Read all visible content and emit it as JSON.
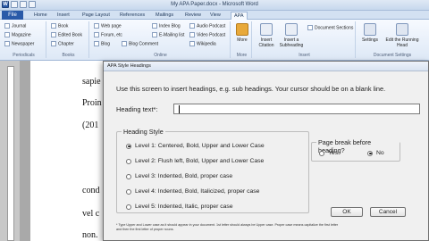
{
  "window": {
    "title": "My APA Paper.docx - Microsoft Word",
    "word_icon_letter": "W"
  },
  "ribbon_tabs": [
    "File",
    "Home",
    "Insert",
    "Page Layout",
    "References",
    "Mailings",
    "Review",
    "View",
    "APA"
  ],
  "ribbon": {
    "periodicals": {
      "label": "Periodicals",
      "items": [
        "Journal",
        "Magazine",
        "Newspaper"
      ]
    },
    "books": {
      "label": "Books",
      "items": [
        "Book",
        "Edited Book",
        "Chapter"
      ]
    },
    "online": {
      "label": "Online",
      "items": [
        "Web page",
        "Forum, etc",
        "Blog",
        "Index Blog",
        "E-Mailing list",
        "Blog Comment",
        "Audio Podcast",
        "Video Podcast",
        "Wikipedia"
      ]
    },
    "more": {
      "label": "More",
      "button": "More"
    },
    "insert": {
      "label": "Insert",
      "citation": "Insert Citation",
      "subheading": "Insert a Subheading",
      "sections": "Document Sections"
    },
    "doc_settings": {
      "label": "Document Settings",
      "settings": "Settings",
      "running_head": "Edit the Running Head"
    }
  },
  "document": {
    "lines": [
      "sapie",
      "Proin",
      "(201",
      "cond",
      "vel c",
      "non."
    ]
  },
  "dialog": {
    "title": "APA Style Headings",
    "instruction": "Use this screen to insert headings, e.g. sub headings. Your cursor should be on a blank line.",
    "heading_label": "Heading text*:",
    "heading_value": "",
    "heading_style": {
      "legend": "Heading Style",
      "options": [
        {
          "label": "Level 1: Centered, Bold, Upper and Lower Case",
          "selected": true
        },
        {
          "label": "Level 2: Flush left, Bold, Upper and Lower Case",
          "selected": false
        },
        {
          "label": "Level 3: Indented, Bold, proper case",
          "selected": false
        },
        {
          "label": "Level 4: Indented, Bold, Italicized, proper case",
          "selected": false
        },
        {
          "label": "Level 5: Indented, Italic, proper case",
          "selected": false
        }
      ]
    },
    "page_break": {
      "legend": "Page break before heading?",
      "yes": "Yes",
      "no": "No",
      "selected": "No"
    },
    "footnote": "* Type Upper and Lower case as it should appear in your document.  1st letter should always be Upper case. Proper case means capitalize the first letter and then the first letter of proper nouns.",
    "ok_label": "OK",
    "cancel_label": "Cancel"
  },
  "colors": {
    "file_tab": "#2a5aa8",
    "ribbon_bg": "#dde8f6",
    "dialog_bg": "#f0f0f0"
  }
}
